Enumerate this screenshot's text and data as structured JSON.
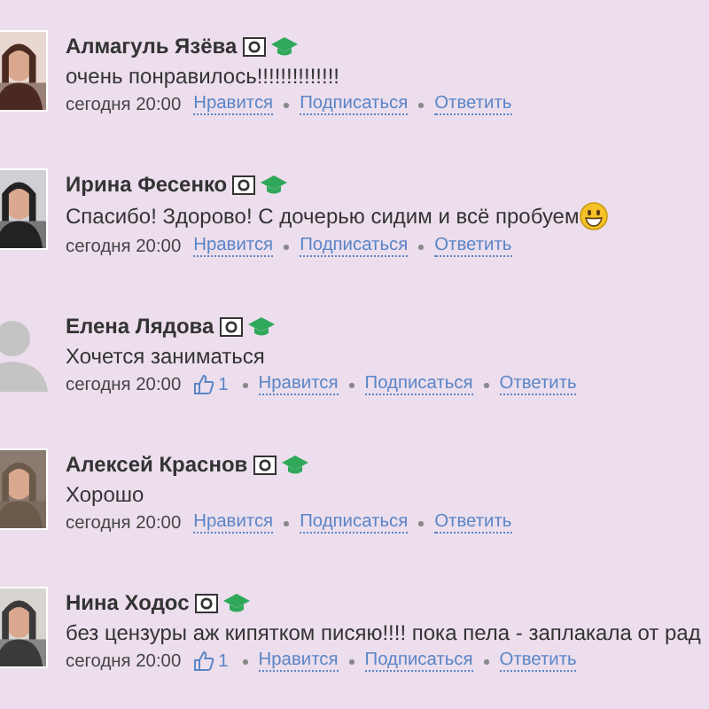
{
  "comments": [
    {
      "author": "Алмагуль Язёва",
      "text": "очень понравилось!!!!!!!!!!!!!!",
      "emoji": false,
      "time": "сегодня 20:00",
      "actions": [
        "Нравится",
        "Подписаться",
        "Ответить"
      ]
    },
    {
      "author": "Ирина Фесенко",
      "text": "Спасибо! Здорово! С дочерью сидим и всё пробуем",
      "emoji": true,
      "time": "сегодня 20:00",
      "actions": [
        "Нравится",
        "Подписаться",
        "Ответить"
      ]
    },
    {
      "author": "Елена Лядова",
      "avatar": {
        "kind": "default"
      },
      "text": "Хочется заниматься",
      "emoji": false,
      "time": "сегодня 20:00",
      "likes": "1",
      "actions": [
        "Нравится",
        "Подписаться",
        "Ответить"
      ]
    },
    {
      "author": "Алексей Краснов",
      "text": "Хорошо",
      "emoji": false,
      "time": "сегодня 20:00",
      "actions": [
        "Нравится",
        "Подписаться",
        "Ответить"
      ]
    },
    {
      "author": "Нина Ходос",
      "text": "без цензуры аж кипятком писяю!!!! пока пела - заплакала от рад",
      "emoji": false,
      "time": "сегодня 20:00",
      "likes": "1",
      "actions": [
        "Нравится",
        "Подписаться",
        "Ответить"
      ]
    }
  ]
}
